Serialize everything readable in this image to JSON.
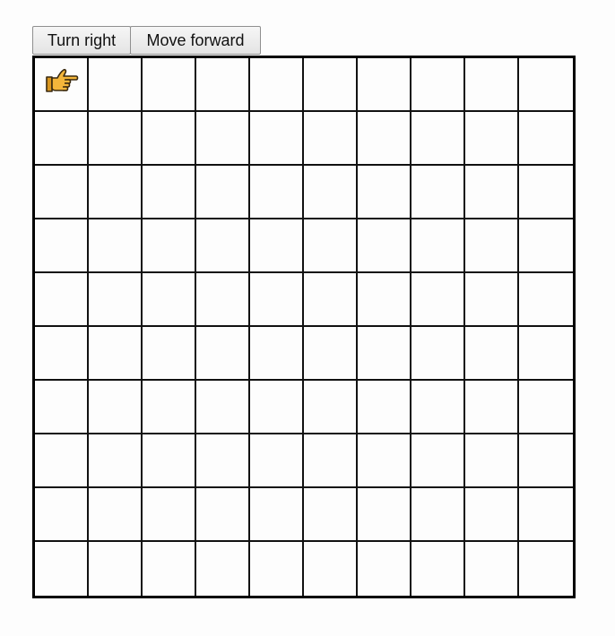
{
  "toolbar": {
    "turn_right_label": "Turn right",
    "move_forward_label": "Move forward"
  },
  "board": {
    "rows": 10,
    "columns": 10,
    "pointer": {
      "row": 1,
      "column": 1,
      "facing": "right",
      "icon": "pointing-hand-right-icon",
      "color": "#f4b63a"
    }
  }
}
